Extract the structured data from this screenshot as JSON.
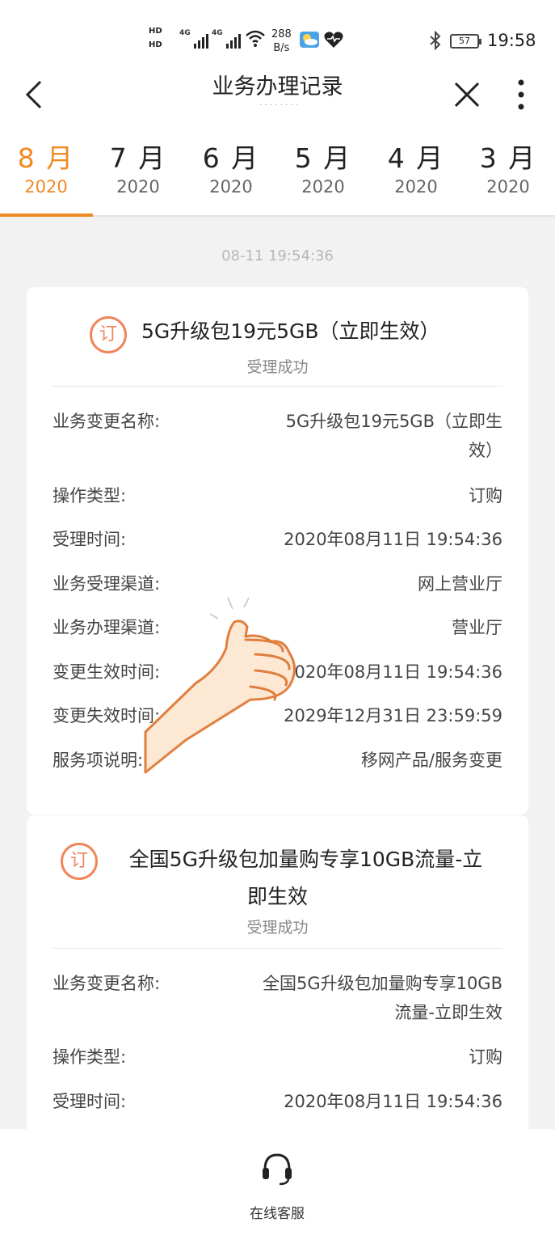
{
  "status_bar": {
    "hd1": "HD",
    "hd2": "HD",
    "net1": "4G",
    "net2": "4G",
    "speed_value": "288",
    "speed_unit": "B/s",
    "battery": "57",
    "time": "19:58",
    "icons": [
      "signal-icon",
      "wifi-icon",
      "weather-icon",
      "health-icon",
      "bluetooth-icon",
      "battery-icon"
    ]
  },
  "nav": {
    "title": "业务办理记录",
    "back_icon": "back-arrow-icon",
    "close_icon": "close-icon",
    "more_icon": "more-vertical-icon"
  },
  "tabs": [
    {
      "month": "8 月",
      "year": "2020",
      "active": true
    },
    {
      "month": "7 月",
      "year": "2020",
      "active": false
    },
    {
      "month": "6 月",
      "year": "2020",
      "active": false
    },
    {
      "month": "5 月",
      "year": "2020",
      "active": false
    },
    {
      "month": "4 月",
      "year": "2020",
      "active": false
    },
    {
      "month": "3 月",
      "year": "2020",
      "active": false
    }
  ],
  "accent_color": "#f08a24",
  "date_stamp": "08-11 19:54:36",
  "records": [
    {
      "badge": "订",
      "name": "5G升级包19元5GB（立即生效）",
      "state": "受理成功",
      "rows": [
        {
          "key": "业务变更名称:",
          "value_line1": "5G升级包19元5GB（立即生",
          "value_line2": "效）"
        },
        {
          "key": "操作类型:",
          "value": "订购"
        },
        {
          "key": "受理时间:",
          "value": "2020年08月11日 19:54:36"
        },
        {
          "key": "业务受理渠道:",
          "value": "网上营业厅"
        },
        {
          "key": "业务办理渠道:",
          "value": "营业厅"
        },
        {
          "key": "变更生效时间:",
          "value": "2020年08月11日 19:54:36"
        },
        {
          "key": "变更失效时间:",
          "value": "2029年12月31日 23:59:59"
        },
        {
          "key": "服务项说明:",
          "value": "移网产品/服务变更"
        }
      ]
    },
    {
      "badge": "订",
      "name_line1": "全国5G升级包加量购专享10GB流量-立",
      "name_line2": "即生效",
      "state": "受理成功",
      "rows": [
        {
          "key": "业务变更名称:",
          "value_line1": "全国5G升级包加量购专享10GB",
          "value_line2": "流量-立即生效"
        },
        {
          "key": "操作类型:",
          "value": "订购"
        },
        {
          "key": "受理时间:",
          "value": "2020年08月11日 19:54:36"
        }
      ]
    }
  ],
  "bottom": {
    "service_icon": "headset-icon",
    "service_label": "在线客服"
  }
}
